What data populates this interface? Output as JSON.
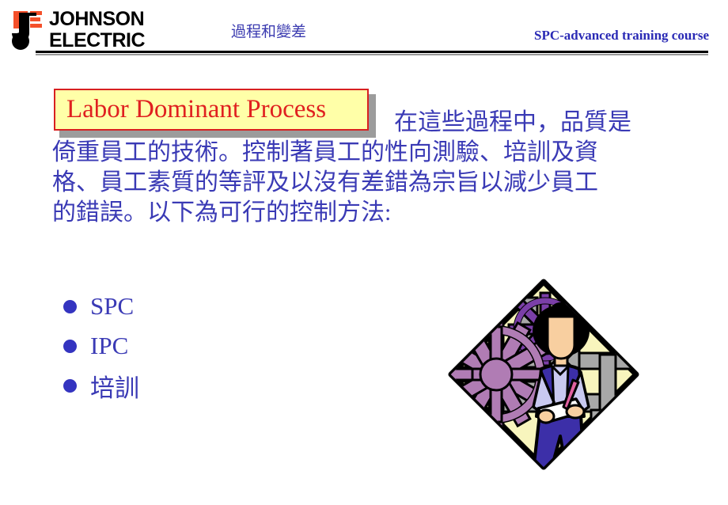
{
  "header": {
    "logo": {
      "name": "johnson-electric-logo",
      "line1": "JOHNSON",
      "line2": "ELECTRIC",
      "mark_color": "#f4502a"
    },
    "subject": "過程和變差",
    "course": "SPC-advanced training course",
    "rule_colors": {
      "thick": "#000000",
      "thin": "#9a9a9a"
    }
  },
  "slide": {
    "title": "Labor Dominant Process",
    "title_colors": {
      "text": "#e02020",
      "fill": "#ffffa8",
      "border": "#d82020",
      "shadow": "#9c9c9c"
    },
    "body": {
      "line1": "在這些過程中，品質是",
      "line2": "倚重員工的技術。控制著員工的性向測驗、培訓及資",
      "line3": "格、員工素質的等評及以沒有差錯為宗旨以減少員工",
      "line4": "的錯誤。以下為可行的控制方法:",
      "color": "#3a3ab5"
    },
    "bullets": [
      {
        "label": "SPC"
      },
      {
        "label": "IPC"
      },
      {
        "label": "培訓"
      }
    ],
    "bullet_color": "#3434c0",
    "illustration": {
      "name": "worker-with-clipboard-and-gears",
      "background": "#f8f5bd",
      "outline": "#000000",
      "gear_large": "#b07cb4",
      "gear_small": "#7b3fa8",
      "machinery": "#a8a8a8",
      "person_vest": "#3c2fa8",
      "person_shirt": "#c9c9f0",
      "person_skin": "#f8cfa0",
      "person_hair": "#000000",
      "pencil": "#e060a0"
    }
  }
}
